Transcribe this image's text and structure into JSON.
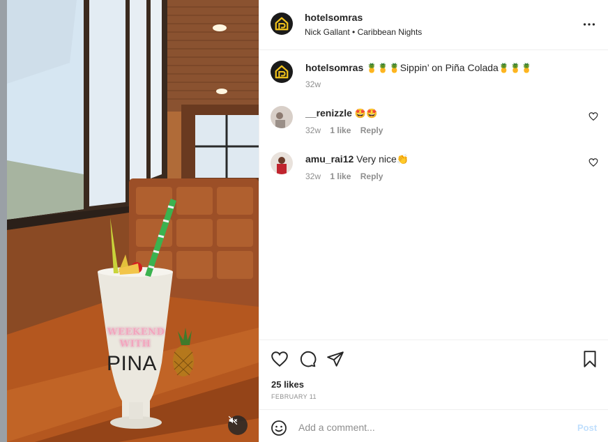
{
  "post": {
    "username": "hotelsomras",
    "audio_artist": "Nick Gallant",
    "audio_separator": "•",
    "audio_track": "Caribbean Nights",
    "more_icon": "more-horizontal-icon"
  },
  "media": {
    "overlay_line1": "WEEKEND",
    "overlay_line2": "WITH",
    "overlay_line3": "PINA",
    "mute_icon": "speaker-muted-icon"
  },
  "caption": {
    "username": "hotelsomras",
    "emoji_before": "🍍🍍🍍",
    "text": "Sippin’ on Piña Colada",
    "emoji_after": "🍍🍍🍍",
    "time": "32w"
  },
  "comments": [
    {
      "username": "__renizzle",
      "text": "🤩🤩",
      "time": "32w",
      "likes": "1 like",
      "reply": "Reply"
    },
    {
      "username": "amu_rai12",
      "text": "Very nice👏",
      "time": "32w",
      "likes": "1 like",
      "reply": "Reply"
    }
  ],
  "actions": {
    "like_icon": "heart-icon",
    "comment_icon": "comment-bubble-icon",
    "share_icon": "paper-plane-icon",
    "save_icon": "bookmark-icon"
  },
  "likes": "25 likes",
  "date": "FEBRUARY 11",
  "add_comment": {
    "placeholder": "Add a comment...",
    "post_label": "Post",
    "emoji_icon": "smiley-icon"
  },
  "colors": {
    "accent_link": "#0095f6",
    "post_disabled": "#c0dffd",
    "secondary_text": "#8e8e8e",
    "logo_yellow": "#f2c31b"
  }
}
